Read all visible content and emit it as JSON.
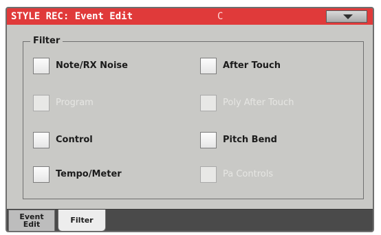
{
  "window": {
    "title": "STYLE REC: Event Edit",
    "mode": "C",
    "menu_icon": "triangle-down-icon",
    "title_color": "#e03a3a"
  },
  "filter": {
    "label": "Filter",
    "items": [
      {
        "label": "Note/RX Noise",
        "enabled": true,
        "checked": false
      },
      {
        "label": "After Touch",
        "enabled": true,
        "checked": false
      },
      {
        "label": "Program",
        "enabled": false,
        "checked": false
      },
      {
        "label": "Poly After Touch",
        "enabled": false,
        "checked": false
      },
      {
        "label": "Control",
        "enabled": true,
        "checked": false
      },
      {
        "label": "Pitch Bend",
        "enabled": true,
        "checked": false
      },
      {
        "label": "Tempo/Meter",
        "enabled": true,
        "checked": false
      },
      {
        "label": "Pa Controls",
        "enabled": false,
        "checked": false
      }
    ]
  },
  "tabs": [
    {
      "label_line1": "Event",
      "label_line2": "Edit",
      "active": false
    },
    {
      "label": "Filter",
      "active": true
    }
  ]
}
